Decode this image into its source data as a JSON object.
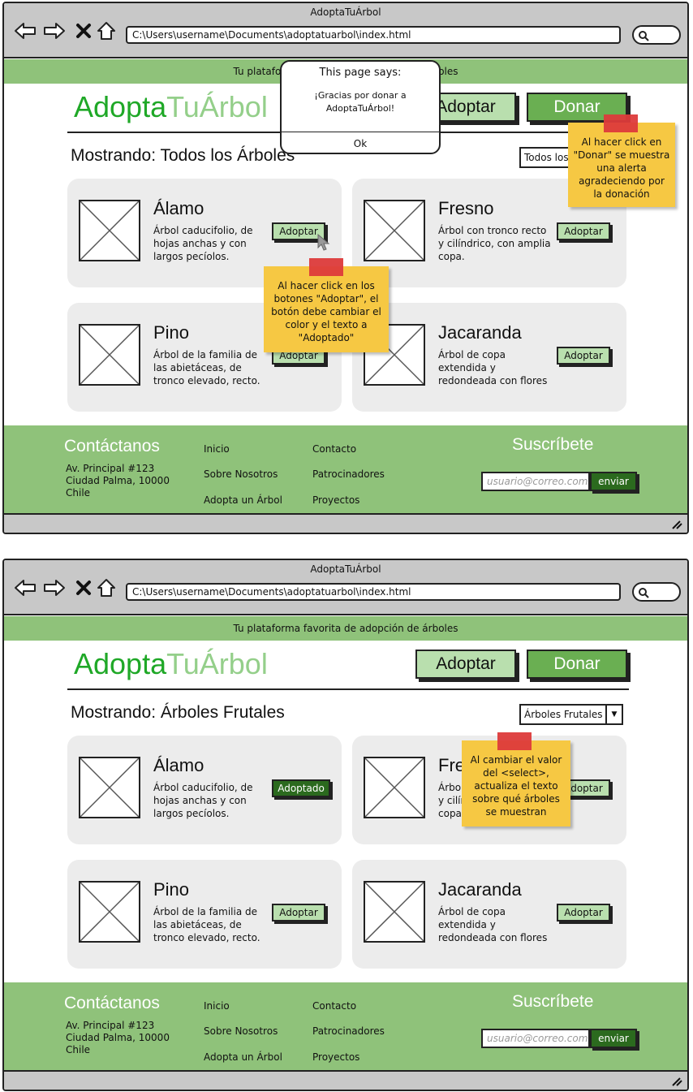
{
  "colors": {
    "banner_green": "#8fc27a",
    "logo_dark_green": "#1fa827",
    "logo_light_green": "#94cf8a",
    "adopt_button": "#b9dfae",
    "donate_button": "#6aaf52",
    "adopted_button": "#2b6a1e",
    "sticky_note": "#f6c843",
    "tape": "#dd3b3b",
    "card_bg": "#ececec"
  },
  "screens": [
    {
      "window_title": "AdoptaTuÁrbol",
      "address": "C:\\Users\\username\\Documents\\adoptatuarbol\\index.html",
      "banner": "Tu plataforma favorita de adopción de árboles",
      "logo": {
        "part1": "Adopta",
        "part2": "TuÁrbol"
      },
      "header_buttons": {
        "adopt": "Adoptar",
        "donate": "Donar"
      },
      "heading": "Mostrando: Todos los Árboles",
      "select_value": "Todos los Árboles",
      "cards": [
        {
          "title": "Álamo",
          "desc": "Árbol caducifolio, de hojas anchas y con largos pecíolos.",
          "button": "Adoptar",
          "adopted": false
        },
        {
          "title": "Fresno",
          "desc": "Árbol con tronco recto y cilíndrico, con amplia copa.",
          "button": "Adoptar",
          "adopted": false
        },
        {
          "title": "Pino",
          "desc": "Árbol de la familia de las abietáceas, de tronco elevado, recto.",
          "button": "Adoptar",
          "adopted": false
        },
        {
          "title": "Jacaranda",
          "desc": "Árbol de copa extendida y redondeada con flores",
          "button": "Adoptar",
          "adopted": false
        }
      ],
      "dialog": {
        "title": "This page says:",
        "message": "¡Gracias por donar a AdoptaTuÁrbol!",
        "ok": "Ok"
      },
      "notes": [
        "Al hacer click en \"Donar\" se muestra una alerta agradeciendo por la donación",
        "Al hacer click en los botones \"Adoptar\", el botón debe cambiar el color y el texto a \"Adoptado\""
      ]
    },
    {
      "window_title": "AdoptaTuÁrbol",
      "address": "C:\\Users\\username\\Documents\\adoptatuarbol\\index.html",
      "banner": "Tu plataforma favorita de adopción de árboles",
      "logo": {
        "part1": "Adopta",
        "part2": "TuÁrbol"
      },
      "header_buttons": {
        "adopt": "Adoptar",
        "donate": "Donar"
      },
      "heading": "Mostrando: Árboles Frutales",
      "select_value": "Árboles Frutales",
      "cards": [
        {
          "title": "Álamo",
          "desc": "Árbol caducifolio, de hojas anchas y con largos pecíolos.",
          "button": "Adoptado",
          "adopted": true
        },
        {
          "title": "Fresno",
          "desc": "Árbol con tronco recto y cilíndrico, con amplia copa.",
          "button": "Adoptar",
          "adopted": false
        },
        {
          "title": "Pino",
          "desc": "Árbol de la familia de las abietáceas, de tronco elevado, recto.",
          "button": "Adoptar",
          "adopted": false
        },
        {
          "title": "Jacaranda",
          "desc": "Árbol de copa extendida y redondeada con flores",
          "button": "Adoptar",
          "adopted": false
        }
      ],
      "notes": [
        "Al cambiar el valor del <select>, actualiza el texto sobre qué árboles se muestran"
      ]
    }
  ],
  "footer": {
    "contact_title": "Contáctanos",
    "address_lines": [
      "Av. Principal #123",
      "Ciudad Palma, 10000",
      "Chile"
    ],
    "links_col1": [
      "Inicio",
      "Sobre Nosotros",
      "Adopta un Árbol"
    ],
    "links_col2": [
      "Contacto",
      "Patrocinadores",
      "Proyectos"
    ],
    "subscribe_title": "Suscríbete",
    "email_placeholder": "usuario@correo.com",
    "send": "enviar"
  },
  "icons": [
    "back-arrow-icon",
    "forward-arrow-icon",
    "close-icon",
    "home-icon",
    "search-icon",
    "placeholder-image-icon",
    "cursor-icon",
    "resize-grip-icon"
  ]
}
